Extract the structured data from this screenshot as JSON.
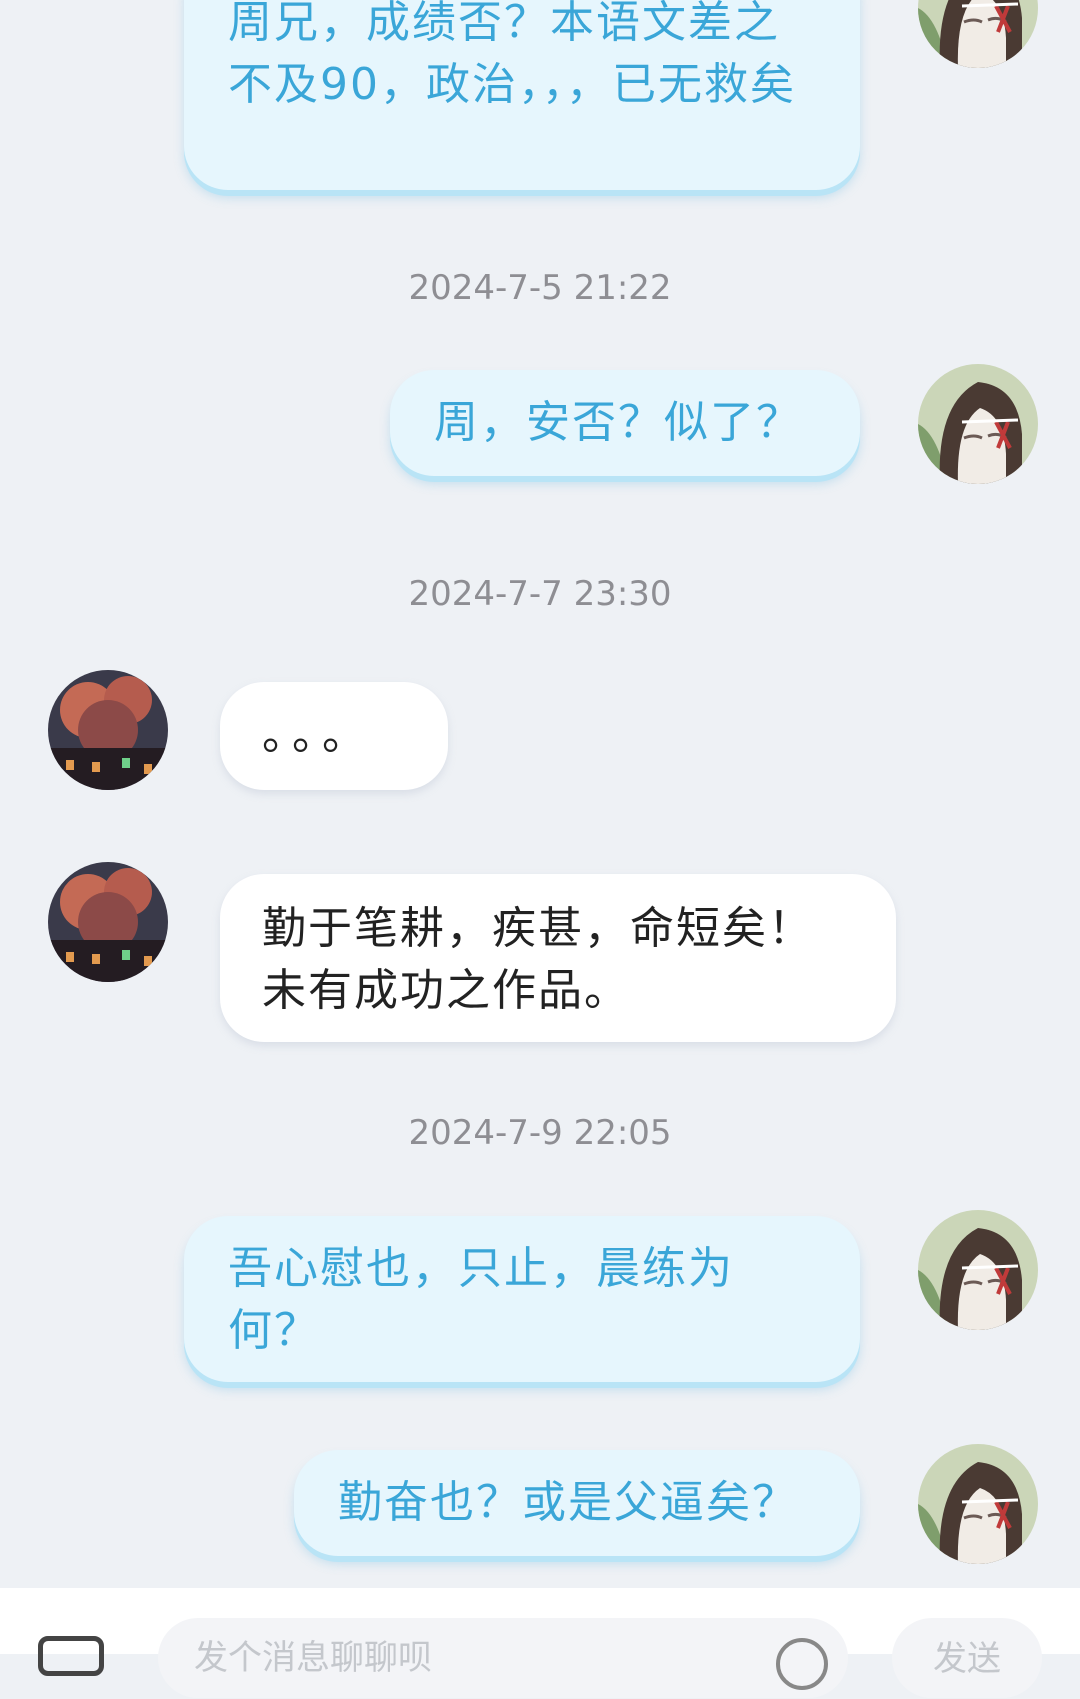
{
  "messages": [
    {
      "side": "out",
      "text": "周兄，成绩否？本语文差之不及90，政治，，，已无救矣"
    },
    {
      "side": "out",
      "text": "周，安否？似了？"
    },
    {
      "side": "in",
      "text": "。。。"
    },
    {
      "side": "in",
      "text": "勤于笔耕，疾甚，命短矣！未有成功之作品。"
    },
    {
      "side": "out",
      "text": "吾心慰也，只止，晨练为何？"
    },
    {
      "side": "out",
      "text": "勤奋也？或是父逼矣？"
    }
  ],
  "timestamps": [
    "2024-7-5 21:22",
    "2024-7-7 23:30",
    "2024-7-9 22:05"
  ],
  "input": {
    "placeholder": "发个消息聊聊呗",
    "send_label": "发送"
  },
  "icons": {
    "image": "image-icon",
    "emoji": "emoji-icon"
  },
  "colors": {
    "background": "#eef1f5",
    "outgoing_bubble": "#e6f6fd",
    "outgoing_text": "#3aa6d8",
    "incoming_bubble": "#ffffff",
    "incoming_text": "#222222",
    "timestamp": "#8e8e93"
  }
}
